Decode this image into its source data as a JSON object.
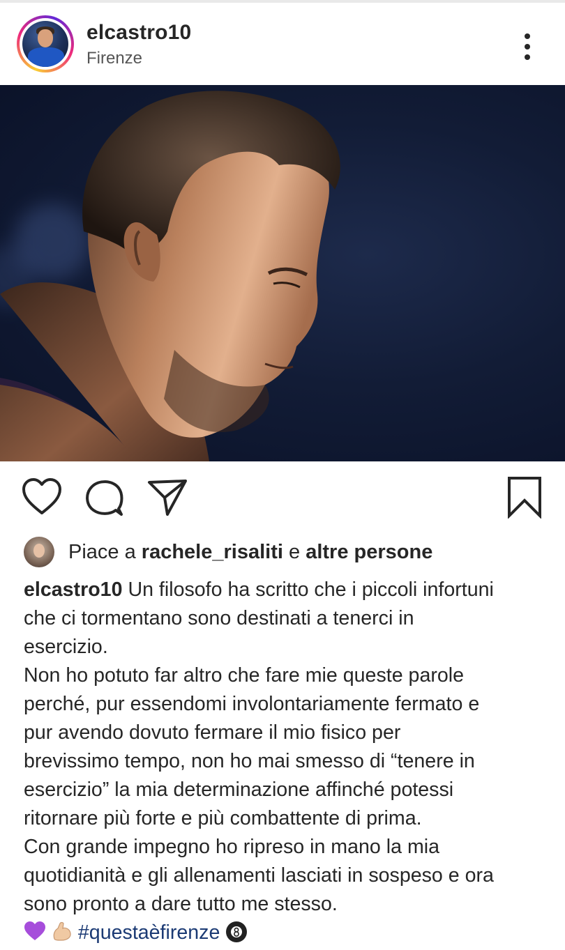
{
  "post": {
    "username": "elcastro10",
    "location": "Firenze",
    "more_icon": "more-vertical-icon"
  },
  "actions": {
    "like_icon": "heart-icon",
    "comment_icon": "comment-icon",
    "share_icon": "send-icon",
    "save_icon": "bookmark-icon"
  },
  "likes": {
    "prefix": "Piace a",
    "user": "rachele_risaliti",
    "conjunction": "e",
    "others": "altre persone"
  },
  "caption": {
    "username": "elcastro10",
    "lines": [
      "Un filosofo ha scritto che i piccoli infortuni",
      "che ci tormentano sono destinati a tenerci in",
      "esercizio.",
      "Non ho potuto far altro che fare mie queste parole",
      "perché, pur essendomi involontariamente fermato e",
      "pur avendo dovuto fermare il mio fisico per",
      "brevissimo tempo, non ho mai smesso di “tenere in",
      "esercizio” la mia determinazione affinché potessi",
      "ritornare più forte e più combattente di prima.",
      "Con grande impegno ho ripreso in mano la mia",
      "quotidianità e gli allenamenti lasciati in sospeso e ora",
      "sono pronto a dare tutto me stesso."
    ],
    "hashtag": "#questaèfirenze",
    "emojis": [
      "purple-heart",
      "flexed-biceps",
      "billiard-8-ball"
    ]
  },
  "colors": {
    "text": "#262626",
    "hashtag": "#1b3a74",
    "photo_bg": "#0f1a33"
  }
}
